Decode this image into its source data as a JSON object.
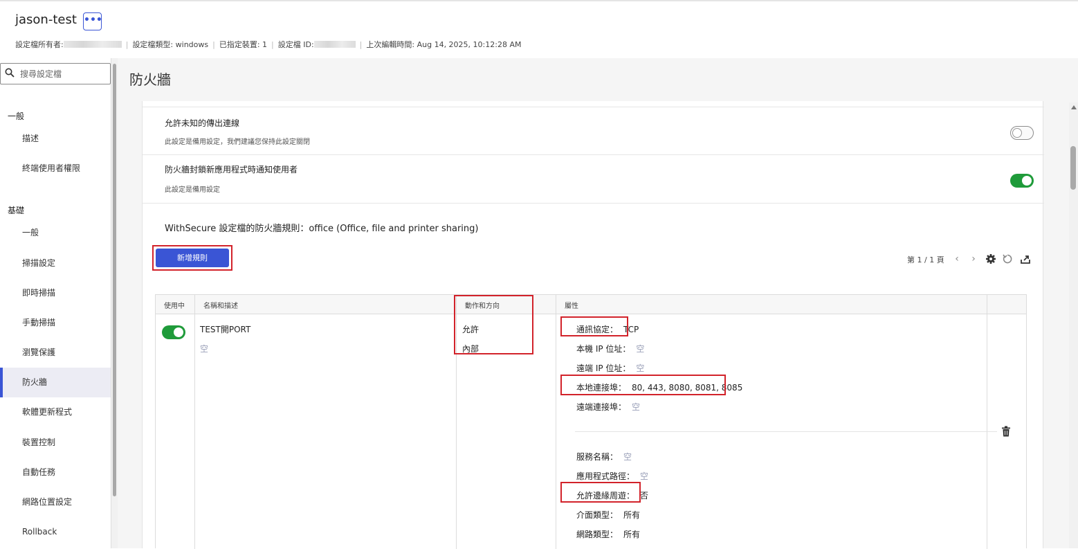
{
  "header": {
    "title": "jason-test",
    "more_label": "•••",
    "owner_label": "設定檔所有者:",
    "type_label": "設定檔類型: windows",
    "devices_label": "已指定裝置: 1",
    "id_label": "設定檔 ID:",
    "edited_label": "上次編輯時間: Aug 14, 2025, 10:12:28 AM"
  },
  "sidebar": {
    "search_placeholder": "搜尋設定檔",
    "sections": [
      {
        "title": "一般",
        "items": [
          "描述",
          "終端使用者權限"
        ]
      },
      {
        "title": "基礎",
        "items": [
          "一般",
          "掃描設定",
          "即時掃描",
          "手動掃描",
          "瀏覽保護",
          "防火牆",
          "軟體更新程式",
          "裝置控制",
          "自動任務",
          "網路位置設定",
          "Rollback"
        ]
      }
    ],
    "active_item": "防火牆"
  },
  "main": {
    "page_title": "防火牆",
    "settings": [
      {
        "title": "允許未知的傳出連線",
        "subtitle": "此設定是備用設定，我們建議您保持此設定關閉",
        "enabled": false
      },
      {
        "title": "防火牆封鎖新應用程式時通知使用者",
        "subtitle": "此設定是備用設定",
        "enabled": true
      }
    ],
    "rules_title": "WithSecure 設定檔的防火牆規則：office (Office, file and printer sharing)",
    "add_rule_label": "新增規則",
    "pager_text": "第 1 / 1 頁",
    "table": {
      "headers": [
        "使用中",
        "名稱和描述",
        "動作和方向",
        "屬性"
      ],
      "rows": [
        {
          "enabled": true,
          "name": "TEST開PORT",
          "description": "空",
          "action": "允許",
          "direction": "內部",
          "properties": [
            {
              "label": "通訊協定：",
              "value": "TCP"
            },
            {
              "label": "本機 IP 位址：",
              "value": "空"
            },
            {
              "label": "遠端 IP 位址：",
              "value": "空"
            },
            {
              "label": "本地連接埠：",
              "value": "80, 443, 8080, 8081, 8085"
            },
            {
              "label": "遠端連接埠：",
              "value": "空"
            },
            {
              "label": "服務名稱：",
              "value": "空"
            },
            {
              "label": "應用程式路徑：",
              "value": "空"
            },
            {
              "label": "允許邊緣周遊：",
              "value": "否"
            },
            {
              "label": "介面類型：",
              "value": "所有"
            },
            {
              "label": "網路類型：",
              "value": "所有"
            }
          ]
        }
      ]
    }
  },
  "colors": {
    "accent": "#3a55d5",
    "toggle_on": "#1f9b3a",
    "highlight": "#d2222a"
  }
}
